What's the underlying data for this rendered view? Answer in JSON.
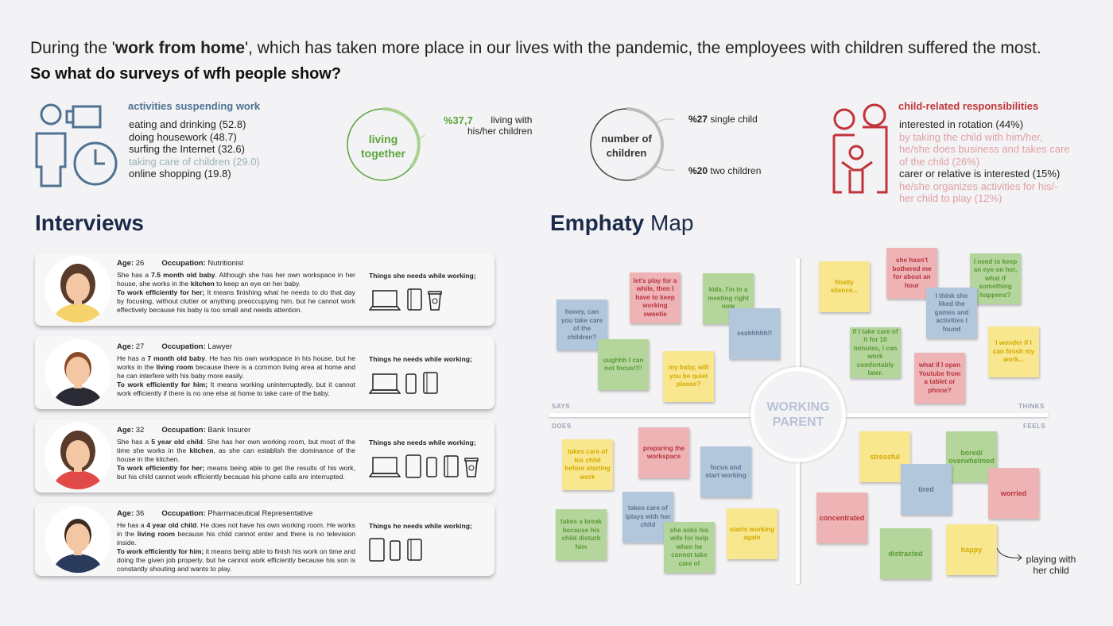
{
  "header": {
    "intro_pre": "During the '",
    "intro_bold": "work from home",
    "intro_post": "', which has taken more place in our lives with the pandemic, the employees with children suffered the most.",
    "question": "So what do surveys of wfh people show?"
  },
  "activities": {
    "title": "activities suspending work",
    "items": [
      "eating and drinking (52.8)",
      "doing housework (48.7)",
      "surfing the Internet (32.6)",
      "taking care of children (29.0)",
      "online shopping (19.8)"
    ],
    "highlight_index": 3
  },
  "living": {
    "ring_label_1": "living",
    "ring_label_2": "together",
    "value": "%37,7",
    "value_fraction": 0.377,
    "desc_1": "living with",
    "desc_2": "his/her children",
    "color": "#5ba33a"
  },
  "children": {
    "ring_label_1": "number of",
    "ring_label_2": "children",
    "single_value": "%27",
    "single_label": "single child",
    "two_value": "%20",
    "two_label": "two children"
  },
  "responsibilities": {
    "title": "child-related responsibilities",
    "items": [
      "interested in rotation (44%)",
      "by taking the child with him/her, he/she does business and takes care of the child (26%)",
      "carer or relative is interested (15%)",
      "he/she organizes activities for his/- her child to play (12%)"
    ],
    "color": "#c0343a"
  },
  "interviews": {
    "title": "Interviews",
    "cards": [
      {
        "age_label": "Age:",
        "age": "26",
        "occ_label": "Occupation:",
        "occupation": "Nutritionist",
        "t1": "She has a ",
        "b1": "7.5 month old baby",
        "t2": ". Although she has her own workspace in her house, she works in the ",
        "b2": "kitchen",
        "t3": " to keep an eye on her baby.",
        "b3": "To work efficiently for her;",
        "t4": " It means finishing what he needs to do that day by focusing, without clutter or anything preoccupying him, but he cannot work effectively because his baby is too small and needs attention.",
        "needs": "Things she needs while working;"
      },
      {
        "age_label": "Age:",
        "age": "27",
        "occ_label": "Occupation:",
        "occupation": "Lawyer",
        "t1": "He has a ",
        "b1": "7 month old baby",
        "t2": ". He has his own workspace in his house, but he works in the ",
        "b2": "living room",
        "t3": " because there is a common living area at home and he can interfere with his baby more easily.",
        "b3": "To work efficiently for him;",
        "t4": " It means working uninterruptedly, but it cannot work efficiently if there is no one else at home to take care of the baby.",
        "needs": "Things he needs while working;"
      },
      {
        "age_label": "Age:",
        "age": "32",
        "occ_label": "Occupation:",
        "occupation": "Bank Insurer",
        "t1": "She has a ",
        "b1": "5 year old child",
        "t2": ". She has her own working room, but most of the time she works in the ",
        "b2": "kitchen",
        "t3": ", as she can establish the dominance of the house in the kitchen.",
        "b3": "To work efficiently for her;",
        "t4": " means being able to get the results of his work, but his child cannot work efficiently because his phone calls are interrupted.",
        "needs": "Things she needs while working;"
      },
      {
        "age_label": "Age:",
        "age": "36",
        "occ_label": "Occupation:",
        "occupation": "Pharmaceutical Representative",
        "t1": "He has a ",
        "b1": "4 year old child",
        "t2": ". He does not have his own working room. He works in the ",
        "b2": "living room",
        "t3": " because his child cannot enter and there is no television inside.",
        "b3": "To work efficiently for him;",
        "t4": " it means being able to finish his work on time and doing the given job properly, but he cannot work efficiently because his son is constantly shouting and wants to play.",
        "needs": "Things he needs while working;"
      }
    ]
  },
  "empathy": {
    "title_bold": "Emphaty",
    "title_rest": " Map",
    "center_1": "WORKING",
    "center_2": "PARENT",
    "says": "SAYS",
    "thinks": "THINKS",
    "does": "DOES",
    "feels": "FEELS",
    "says_notes": [
      "honey, can you take care of the children?",
      "let's play for a while, then I have to keep working sweetie",
      "kids, I'm in a meeting right now",
      "ssshhhhh!!",
      "uughhh I can not focus!!!!",
      "my baby, will you be quiet please?"
    ],
    "thinks_notes": [
      "finally silence...",
      "she hasn't bothered me for about an hour",
      "I need to keep an eye on her, what if something happens?",
      "I think she liked the games and activities I found",
      "if I take care of it for 10 minutes, I can work comfortably later.",
      "I wonder if I can finish my work...",
      "what if I open Youtube from a tablet or phone?"
    ],
    "does_notes": [
      "takes care of his child before starting work",
      "preparing the workspace",
      "focus and start working",
      "takes care of /plays with her child",
      "takes a break because his child disturb him",
      "she asks his wife for help when he cannot take care of",
      "starts working again"
    ],
    "feels_notes": [
      "stressful",
      "bored/ overwhelmed",
      "tired",
      "worried",
      "concentrated",
      "distracted",
      "happy"
    ],
    "annotation": "playing with her child"
  }
}
